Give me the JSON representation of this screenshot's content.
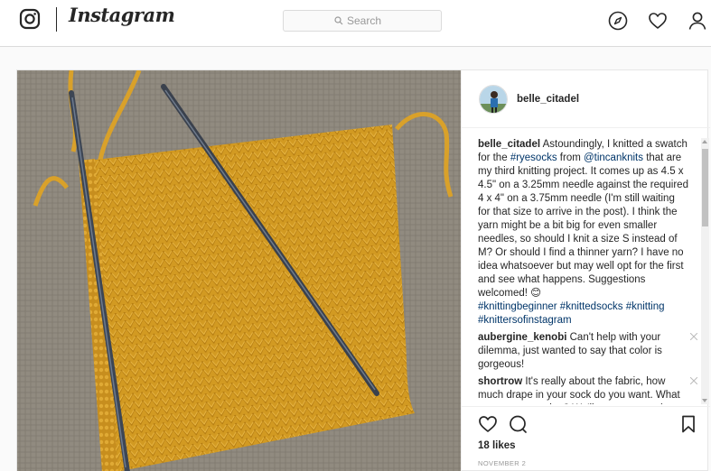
{
  "app": {
    "name": "Instagram"
  },
  "nav": {
    "search_placeholder": "Search",
    "icons": [
      "instagram-glyph-icon",
      "search-icon",
      "compass-icon",
      "heart-icon",
      "profile-icon"
    ]
  },
  "post": {
    "username": "belle_citadel",
    "caption": {
      "username": "belle_citadel",
      "t1": " Astoundingly, I knitted a swatch for the ",
      "tag_rye": "#ryesocks",
      "t2": " from ",
      "mention": "@tincanknits",
      "t3": " that are my third knitting project. It comes up as 4.5 x 4.5\" on a 3.25mm needle against the required 4 x 4\" on a 3.75mm needle (I'm still waiting for that size to arrive in the post). I think the yarn might be a bit big for even smaller needles, so should I knit a size S instead of M? Or should I find a thinner yarn? I have no idea whatsoever but may well opt for the first and see what happens. Suggestions welcomed! ",
      "emoji": "😊",
      "tag1": "#knittingbeginner",
      "tag2": "#knittedsocks",
      "tag3": "#knitting",
      "tag4": "#knittersofinstagram"
    },
    "comments": [
      {
        "username": "aubergine_kenobi",
        "text": " Can't help with your dilemma, just wanted to say that color is gorgeous!"
      },
      {
        "username": "shortrow",
        "text": " It's really about the fabric, how much drape in your sock do you want. What yarn are you using? We'll get you sorted."
      }
    ],
    "likes": "18 likes",
    "date": "NOVEMBER 2"
  },
  "colors": {
    "link": "#003569",
    "yarn": "#d9a12a",
    "border": "#dbdbdb"
  }
}
